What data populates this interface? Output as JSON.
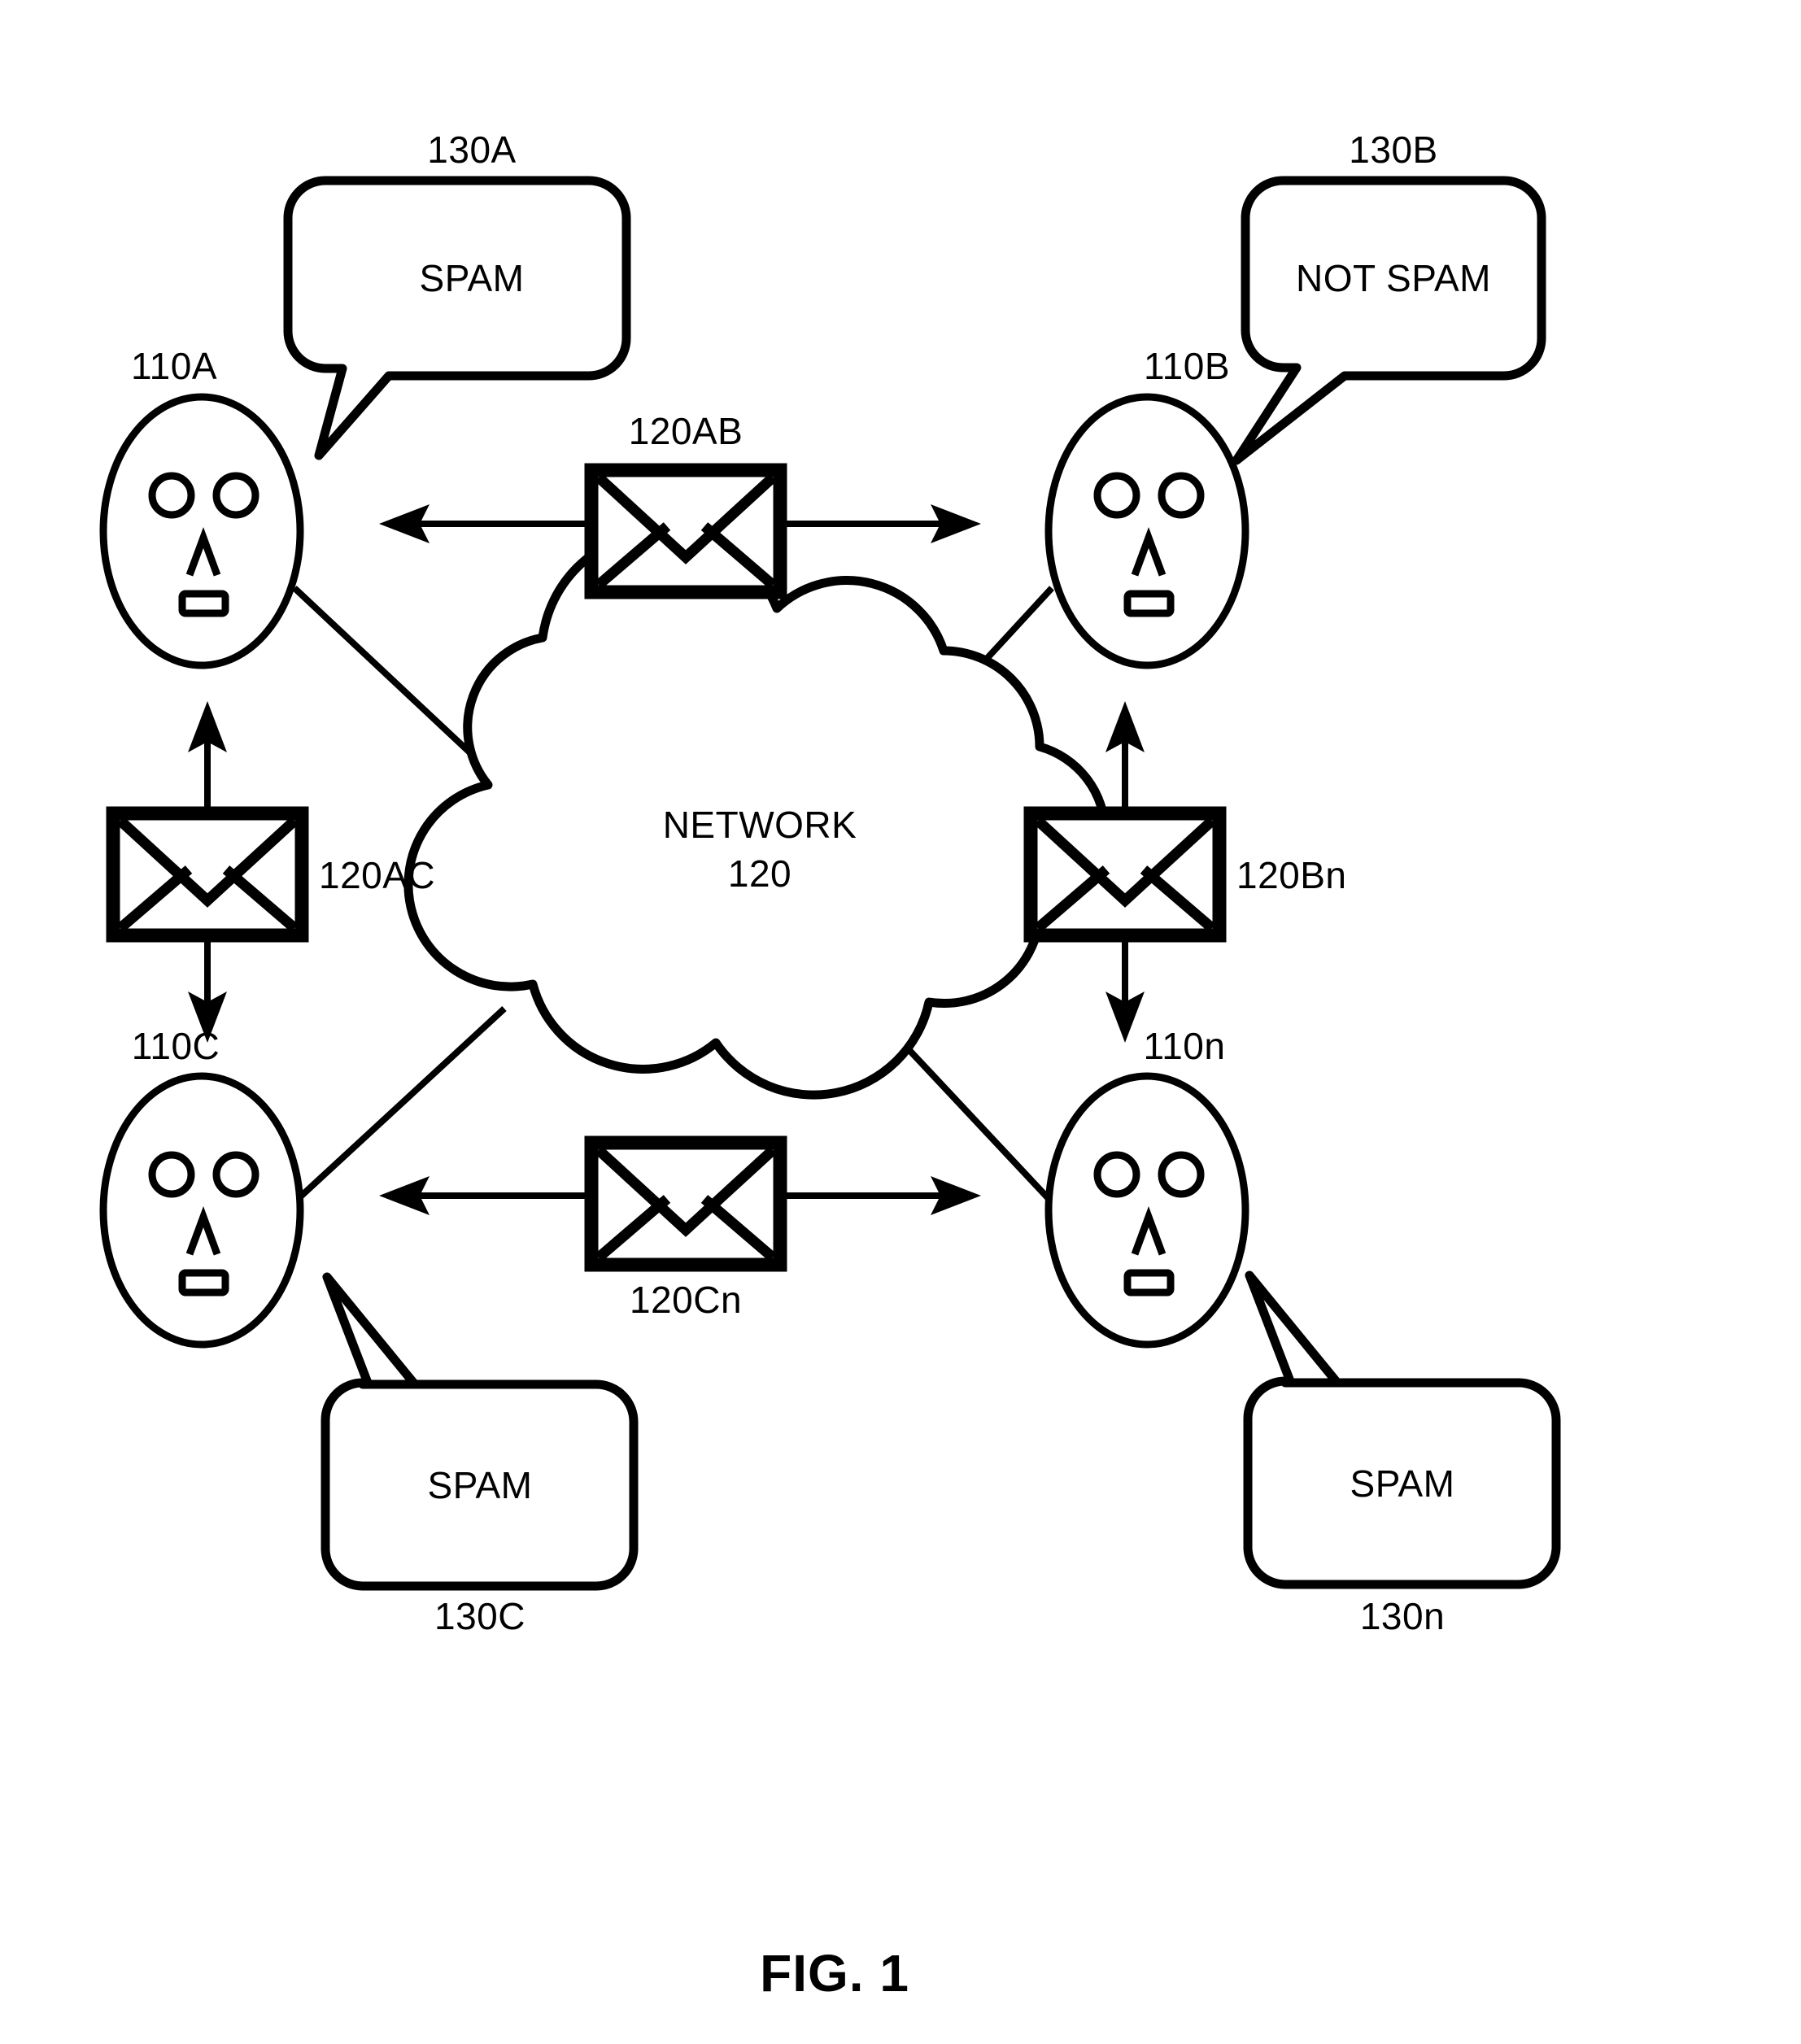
{
  "figure": {
    "caption": "FIG. 1",
    "network": {
      "label_line1": "NETWORK",
      "label_line2": "120"
    },
    "clients": [
      {
        "ref": "110A",
        "position": "top-left"
      },
      {
        "ref": "110B",
        "position": "top-right"
      },
      {
        "ref": "110C",
        "position": "bottom-left"
      },
      {
        "ref": "110n",
        "position": "bottom-right"
      }
    ],
    "messages": [
      {
        "ref": "120AB",
        "orientation": "horizontal",
        "position": "top-center"
      },
      {
        "ref": "120AC",
        "orientation": "vertical",
        "position": "middle-left"
      },
      {
        "ref": "120Bn",
        "orientation": "vertical",
        "position": "middle-right"
      },
      {
        "ref": "120Cn",
        "orientation": "horizontal",
        "position": "bottom-center"
      }
    ],
    "verdicts": [
      {
        "ref": "130A",
        "text": "SPAM",
        "owner": "110A"
      },
      {
        "ref": "130B",
        "text": "NOT SPAM",
        "owner": "110B"
      },
      {
        "ref": "130C",
        "text": "SPAM",
        "owner": "110C"
      },
      {
        "ref": "130n",
        "text": "SPAM",
        "owner": "110n"
      }
    ],
    "colors": {
      "ink": "#000000",
      "paper": "#ffffff"
    }
  }
}
